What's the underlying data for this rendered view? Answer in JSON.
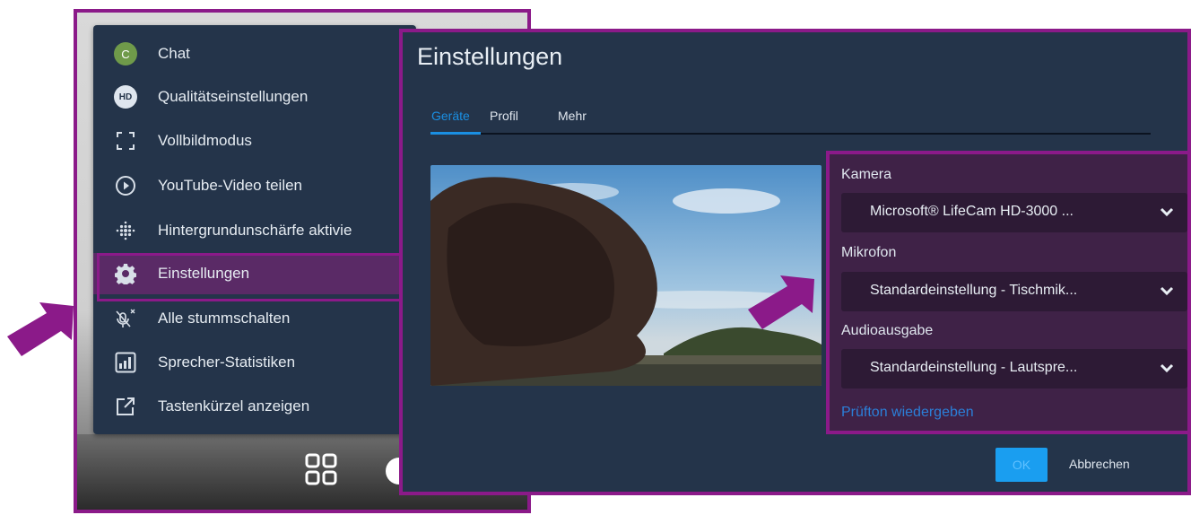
{
  "menu": {
    "items": [
      {
        "label": "Chat",
        "icon": "chat-avatar-icon"
      },
      {
        "label": "Qualitätseinstellungen",
        "icon": "hd-icon"
      },
      {
        "label": "Vollbildmodus",
        "icon": "fullscreen-icon"
      },
      {
        "label": "YouTube-Video teilen",
        "icon": "play-circle-icon"
      },
      {
        "label": "Hintergrundunschärfe aktivie",
        "icon": "blur-icon"
      },
      {
        "label": "Einstellungen",
        "icon": "gear-icon"
      },
      {
        "label": "Alle stummschalten",
        "icon": "mute-all-icon"
      },
      {
        "label": "Sprecher-Statistiken",
        "icon": "stats-icon"
      },
      {
        "label": "Tastenkürzel anzeigen",
        "icon": "external-link-icon"
      }
    ],
    "avatar_letter": "C",
    "hd_text": "HD"
  },
  "dialog": {
    "title": "Einstellungen",
    "tabs": [
      "Geräte",
      "Profil",
      "Mehr"
    ],
    "camera_label": "Kamera",
    "camera_value": "Microsoft® LifeCam HD-3000 ...",
    "mic_label": "Mikrofon",
    "mic_value": "Standardeinstellung - Tischmik...",
    "audio_label": "Audioausgabe",
    "audio_value": "Standardeinstellung - Lautspre...",
    "test_tone": "Prüfton wiedergeben",
    "ok": "OK",
    "cancel": "Abbrechen"
  },
  "colors": {
    "highlight": "#8b1a89",
    "panel": "#24344a",
    "accent": "#1a9ef0",
    "link": "#2b7fd8"
  }
}
